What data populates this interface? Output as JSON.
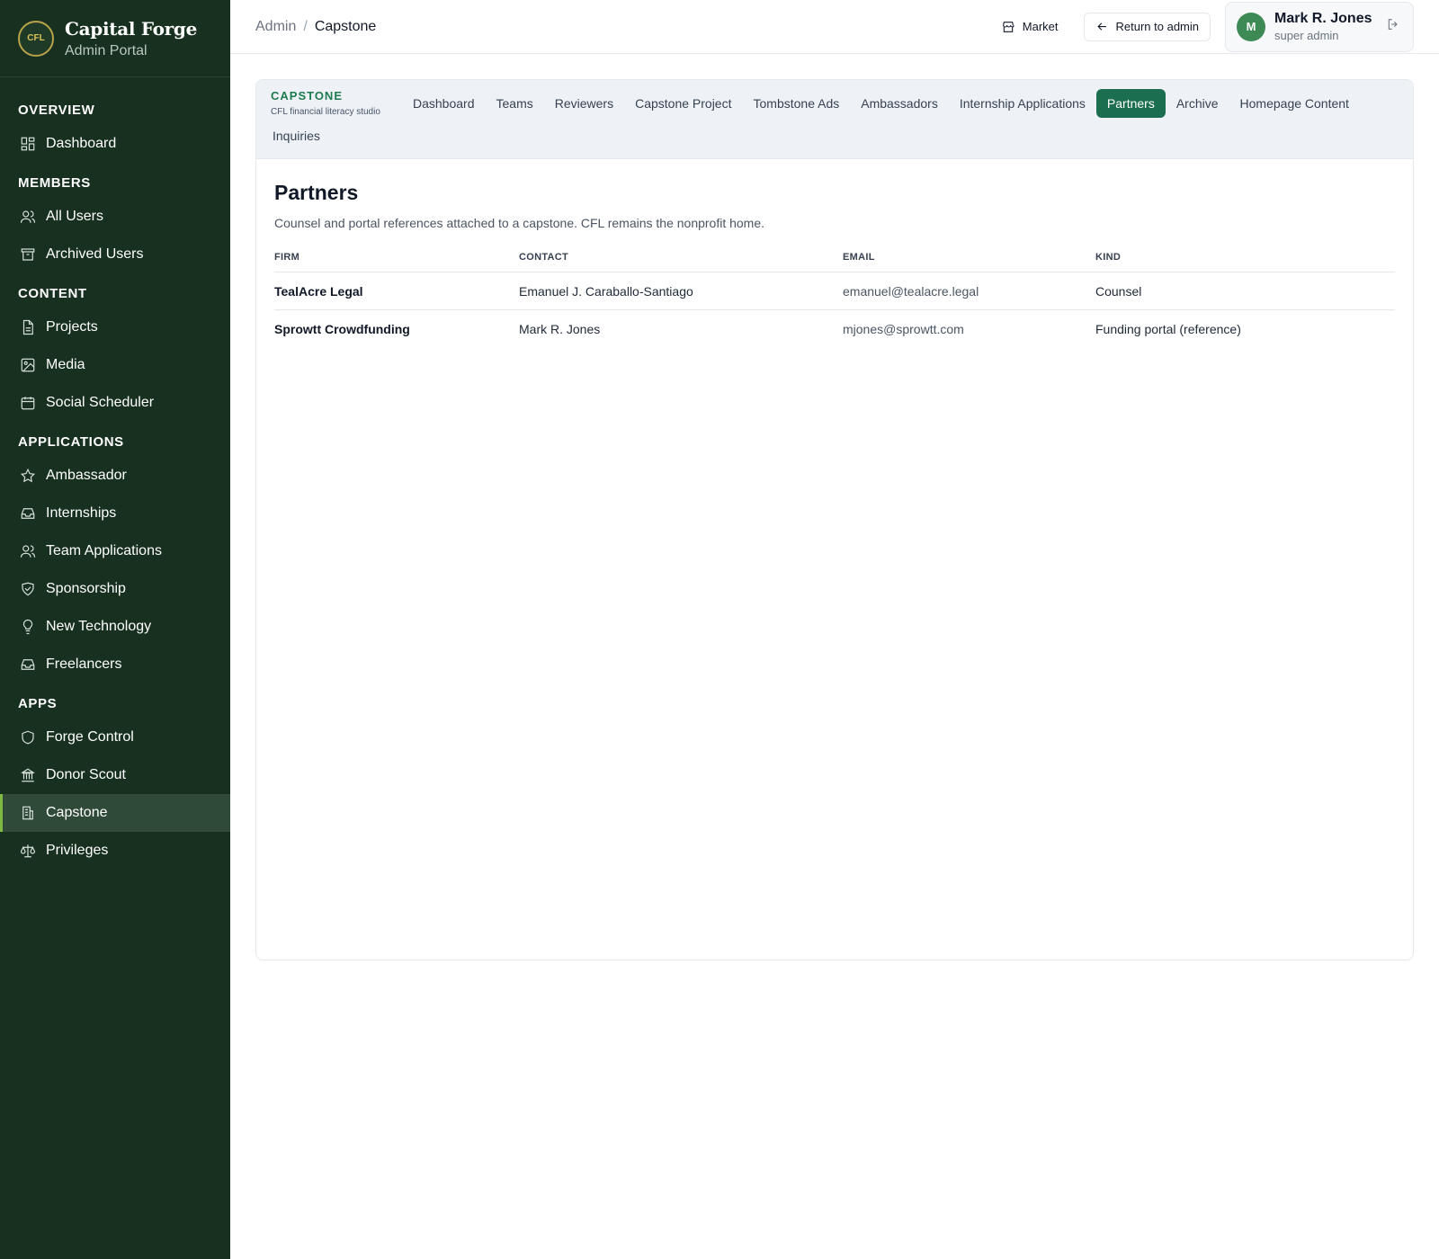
{
  "brand": {
    "title": "Capital Forge",
    "subtitle": "Admin Portal",
    "logo_text": "CFL"
  },
  "sidebar": {
    "groups": [
      {
        "title": "OVERVIEW",
        "items": [
          {
            "label": "Dashboard",
            "icon": "dashboard-icon"
          }
        ]
      },
      {
        "title": "MEMBERS",
        "items": [
          {
            "label": "All Users",
            "icon": "users-icon"
          },
          {
            "label": "Archived Users",
            "icon": "archive-icon"
          }
        ]
      },
      {
        "title": "CONTENT",
        "items": [
          {
            "label": "Projects",
            "icon": "file-icon"
          },
          {
            "label": "Media",
            "icon": "image-icon"
          },
          {
            "label": "Social Scheduler",
            "icon": "calendar-icon"
          }
        ]
      },
      {
        "title": "APPLICATIONS",
        "items": [
          {
            "label": "Ambassador",
            "icon": "star-icon"
          },
          {
            "label": "Internships",
            "icon": "inbox-icon"
          },
          {
            "label": "Team Applications",
            "icon": "users-icon"
          },
          {
            "label": "Sponsorship",
            "icon": "handshake-icon"
          },
          {
            "label": "New Technology",
            "icon": "lightbulb-icon"
          },
          {
            "label": "Freelancers",
            "icon": "inbox-icon"
          }
        ]
      },
      {
        "title": "APPS",
        "items": [
          {
            "label": "Forge Control",
            "icon": "shield-icon"
          },
          {
            "label": "Donor Scout",
            "icon": "bank-icon"
          },
          {
            "label": "Capstone",
            "icon": "building-icon",
            "active": true
          },
          {
            "label": "Privileges",
            "icon": "scale-icon"
          }
        ]
      }
    ]
  },
  "topbar": {
    "breadcrumb": [
      "Admin",
      "Capstone"
    ],
    "market_label": "Market",
    "return_label": "Return to admin",
    "user": {
      "name": "Mark R. Jones",
      "role": "super admin",
      "initial": "M"
    }
  },
  "capstone": {
    "title": "CAPSTONE",
    "subtitle": "CFL financial literacy studio",
    "tabs": [
      "Dashboard",
      "Teams",
      "Reviewers",
      "Capstone Project",
      "Tombstone Ads",
      "Ambassadors",
      "Internship Applications",
      "Partners",
      "Archive",
      "Homepage Content"
    ],
    "tabs_row2": [
      "Inquiries"
    ],
    "active_tab": "Partners"
  },
  "section": {
    "title": "Partners",
    "description": "Counsel and portal references attached to a capstone. CFL remains the nonprofit home."
  },
  "table": {
    "columns": [
      "FIRM",
      "CONTACT",
      "EMAIL",
      "KIND"
    ],
    "rows": [
      [
        "TealAcre Legal",
        "Emanuel J. Caraballo-Santiago",
        "emanuel@tealacre.legal",
        "Counsel"
      ],
      [
        "Sprowtt Crowdfunding",
        "Mark R. Jones",
        "mjones@sprowtt.com",
        "Funding portal (reference)"
      ]
    ]
  },
  "colors": {
    "sidebar_bg": "#17301f",
    "accent": "#1c6e50",
    "active_bar": "#7fb843"
  }
}
